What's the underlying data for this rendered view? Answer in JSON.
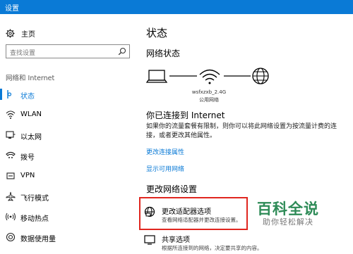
{
  "window": {
    "title": "设置"
  },
  "sidebar": {
    "home_label": "主页",
    "search_placeholder": "查找设置",
    "section_label": "网络和 Internet",
    "items": [
      {
        "label": "状态",
        "icon": "status-icon"
      },
      {
        "label": "WLAN",
        "icon": "wifi-icon"
      },
      {
        "label": "以太网",
        "icon": "ethernet-icon"
      },
      {
        "label": "拨号",
        "icon": "dialup-icon"
      },
      {
        "label": "VPN",
        "icon": "vpn-icon"
      },
      {
        "label": "飞行模式",
        "icon": "airplane-icon"
      },
      {
        "label": "移动热点",
        "icon": "hotspot-icon"
      },
      {
        "label": "数据使用量",
        "icon": "data-usage-icon"
      }
    ]
  },
  "main": {
    "title": "状态",
    "network_status_heading": "网络状态",
    "network_name": "wsfxzxb_2.4G",
    "network_type": "公用网络",
    "connected_heading": "你已连接到 Internet",
    "connected_desc": "如果你的流量套餐有限制，则你可以将此网络设置为按流量计费的连接，或者更改其他属性。",
    "links": {
      "change_props": "更改连接属性",
      "show_networks": "显示可用网络"
    },
    "change_settings_heading": "更改网络设置",
    "options": [
      {
        "title": "更改适配器选项",
        "desc": "查看网络适配器并更改连接设置。"
      },
      {
        "title": "共享选项",
        "desc": "根据所连接到的网络，决定要共享的内容。"
      }
    ]
  },
  "watermark": {
    "brand": "百科全说",
    "slogan": "助你轻松解决"
  },
  "colors": {
    "accent": "#0a7ad6",
    "highlight_box": "#e0261f",
    "watermark": "#2e8b57"
  }
}
